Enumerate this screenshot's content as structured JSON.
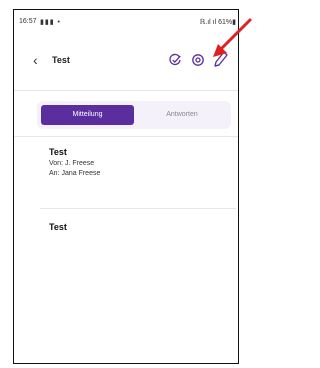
{
  "status_bar": {
    "time": "16:57",
    "left_icons": "▮▮▮ •",
    "right": "ℝ.ıl ıl 61%▮"
  },
  "header": {
    "back_glyph": "‹",
    "title": "Test"
  },
  "tabs": [
    {
      "label": "Mitteilung",
      "active": true
    },
    {
      "label": "Antworten",
      "active": false
    }
  ],
  "message": {
    "title": "Test",
    "from": "Von: J. Freese",
    "to": "An: Jana Freese"
  },
  "body": {
    "title": "Test"
  },
  "colors": {
    "accent": "#5a2e9e",
    "annotation_arrow": "#e02020",
    "icon": "#5a2e9e"
  }
}
